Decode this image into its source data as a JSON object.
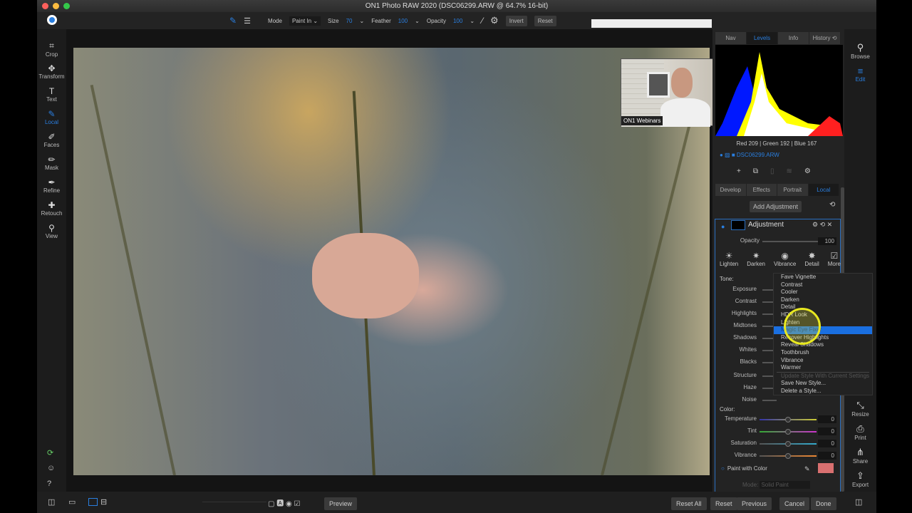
{
  "window": {
    "title": "ON1 Photo RAW 2020 (DSC06299.ARW @ 64.7% 16-bit)"
  },
  "toolbar": {
    "mode_label": "Mode",
    "mode_value": "Paint In",
    "size_label": "Size",
    "size_value": "70",
    "feather_label": "Feather",
    "feather_value": "100",
    "opacity_label": "Opacity",
    "opacity_value": "100",
    "invert": "Invert",
    "reset": "Reset"
  },
  "tools": [
    {
      "label": "Crop",
      "icon": "⌗"
    },
    {
      "label": "Transform",
      "icon": "✥"
    },
    {
      "label": "Text",
      "icon": "T"
    },
    {
      "label": "Local",
      "icon": "✎"
    },
    {
      "label": "Faces",
      "icon": "✐"
    },
    {
      "label": "Mask",
      "icon": "✏"
    },
    {
      "label": "Refine",
      "icon": "✒"
    },
    {
      "label": "Retouch",
      "icon": "✚"
    },
    {
      "label": "View",
      "icon": "⚲"
    }
  ],
  "webcam": {
    "caption": "ON1 Webinars"
  },
  "panel": {
    "top_tabs": [
      "Nav",
      "Levels",
      "Info",
      "History ⟲"
    ],
    "active_top_tab": "Levels",
    "rgb_readout": "Red 209 | Green 192 | Blue 167",
    "layer_name": "DSC06299.ARW",
    "module_tabs": [
      "Develop",
      "Effects",
      "Portrait",
      "Local"
    ],
    "active_module_tab": "Local",
    "add_adjustment": "Add Adjustment",
    "adjustment_title": "Adjustment",
    "opacity_label": "Opacity",
    "opacity_value": "100",
    "presets": [
      "Lighten",
      "Darken",
      "Vibrance",
      "Detail",
      "More"
    ],
    "tone_label": "Tone:",
    "tone_sliders": [
      "Exposure",
      "Contrast",
      "Highlights",
      "Midtones",
      "Shadows",
      "Whites",
      "Blacks",
      "Structure",
      "Haze",
      "Noise"
    ],
    "color_label": "Color:",
    "color_sliders": [
      {
        "label": "Temperature",
        "value": "0"
      },
      {
        "label": "Tint",
        "value": "0"
      },
      {
        "label": "Saturation",
        "value": "0"
      },
      {
        "label": "Vibrance",
        "value": "0"
      }
    ],
    "paint_with_color": "Paint with Color",
    "paint_color": "#d97070",
    "mode_label": "Mode:",
    "mode_value": "Solid Paint"
  },
  "style_menu": {
    "items": [
      "Fave Vignette",
      "Contrast",
      "Cooler",
      "Darken",
      "Detail",
      "HDR Look",
      "Lighten",
      "Magic Eye Fixer",
      "Recover Highlights",
      "Reveal Shadows",
      "Toothbrush",
      "Vibrance",
      "Warmer"
    ],
    "selected": "Magic Eye Fixer",
    "actions": [
      "Update Style With Current Settings",
      "Save New Style...",
      "Delete a Style..."
    ],
    "disabled_action": "Update Style With Current Settings"
  },
  "nav": [
    {
      "label": "Browse",
      "icon": "⚲"
    },
    {
      "label": "Edit",
      "icon": "≡"
    }
  ],
  "nav_bottom": [
    {
      "label": "Resize",
      "icon": "⤡"
    },
    {
      "label": "Print",
      "icon": "⎙"
    },
    {
      "label": "Share",
      "icon": "⋔"
    },
    {
      "label": "Export",
      "icon": "⇪"
    }
  ],
  "bottom": {
    "preview": "Preview",
    "reset_all": "Reset All",
    "reset": "Reset",
    "previous": "Previous",
    "cancel": "Cancel",
    "done": "Done"
  },
  "colors": {
    "accent": "#2a7fe0",
    "menu_highlight": "#1a6fe0"
  }
}
